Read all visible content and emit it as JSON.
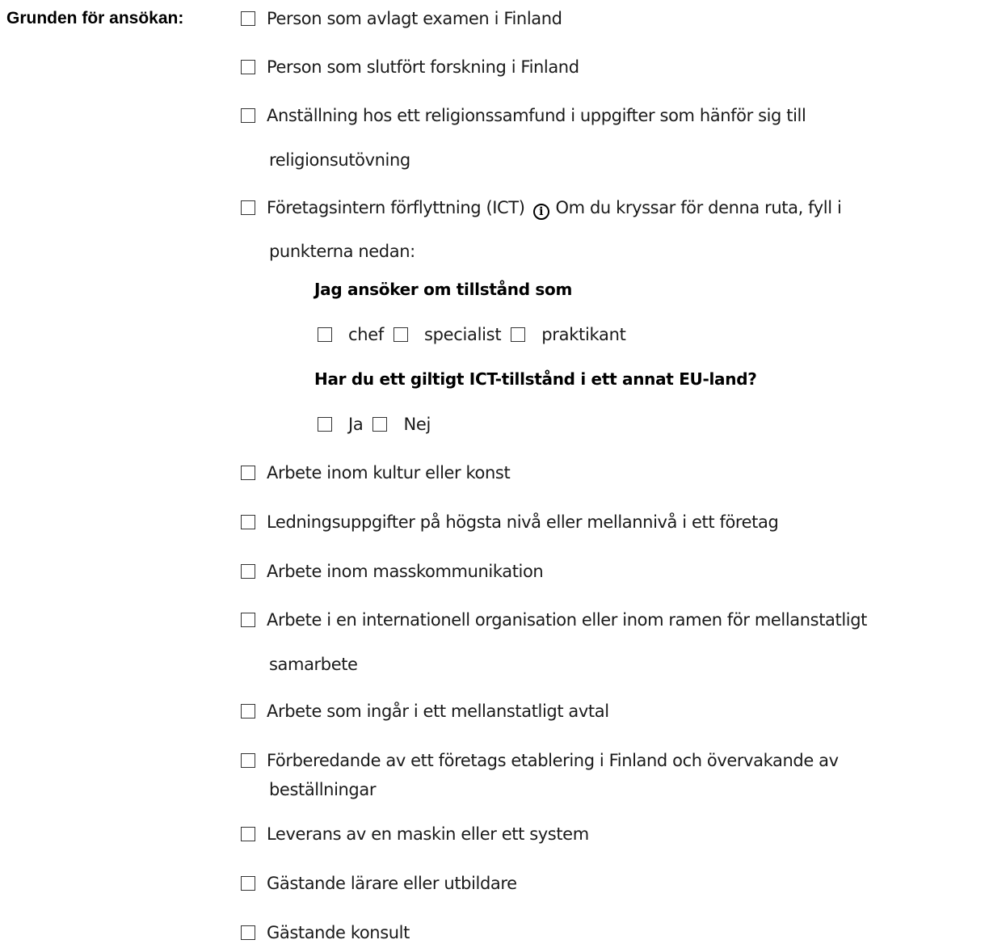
{
  "form": {
    "label": "Grunden för ansökan:",
    "options": [
      {
        "text": "Person som avlagt examen i Finland"
      },
      {
        "text": "Person som slutfört forskning i Finland"
      },
      {
        "text": "Anställning hos ett religionssamfund i uppgifter som hänför sig till",
        "cont": "religionsutövning"
      },
      {
        "text": "Företagsintern förflyttning (ICT)",
        "note": "Om du kryssar för denna ruta, fyll i",
        "cont": "punkterna nedan:"
      },
      {
        "text": "Arbete inom kultur eller konst"
      },
      {
        "text": "Ledningsuppgifter på högsta nivå eller mellannivå i ett företag"
      },
      {
        "text": "Arbete inom masskommunikation"
      },
      {
        "text": "Arbete i en internationell organisation eller inom ramen för mellanstatligt",
        "cont": "samarbete"
      },
      {
        "text": "Arbete som ingår i ett mellanstatligt avtal"
      },
      {
        "text": "Förberedande av ett företags etablering i Finland och övervakande av",
        "cont": "beställningar"
      },
      {
        "text": "Leverans av en maskin eller ett system"
      },
      {
        "text": "Gästande lärare eller utbildare"
      },
      {
        "text": "Gästande konsult"
      }
    ]
  },
  "ict": {
    "role_heading": "Jag ansöker om tillstånd som",
    "roles": [
      "chef",
      "specialist",
      "praktikant"
    ],
    "permit_heading": "Har du ett giltigt ICT-tillstånd i ett annat EU-land?",
    "answers": [
      "Ja",
      "Nej"
    ],
    "info_icon_glyph": "i"
  },
  "icons": {
    "checkbox": "checkbox-icon",
    "info": "info-icon"
  }
}
